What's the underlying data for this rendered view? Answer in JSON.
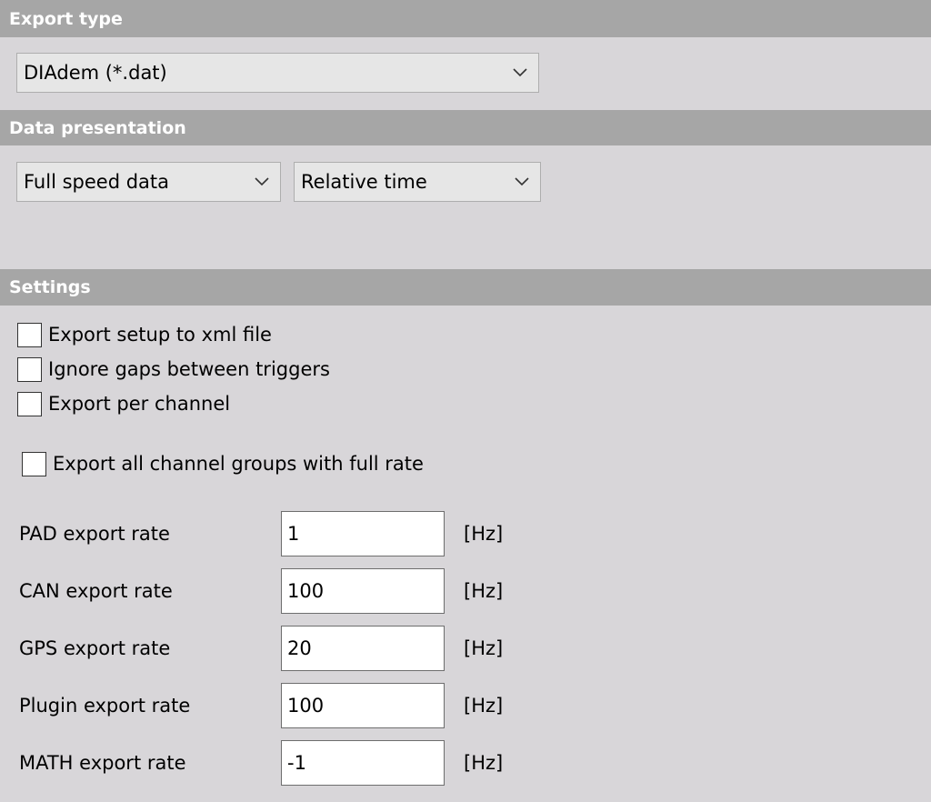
{
  "export_type": {
    "header": "Export type",
    "selected": "DIAdem (*.dat)"
  },
  "data_presentation": {
    "header": "Data presentation",
    "data_mode": "Full speed data",
    "time_mode": "Relative time"
  },
  "settings": {
    "header": "Settings",
    "checkboxes": [
      {
        "label": "Export setup to xml file",
        "checked": false
      },
      {
        "label": "Ignore gaps between triggers",
        "checked": false
      },
      {
        "label": "Export per channel",
        "checked": false
      },
      {
        "label": "Export all channel groups with full rate",
        "checked": false
      }
    ],
    "rates": [
      {
        "label": "PAD export rate",
        "value": "1",
        "unit": "[Hz]"
      },
      {
        "label": "CAN export rate",
        "value": "100",
        "unit": "[Hz]"
      },
      {
        "label": "GPS export rate",
        "value": "20",
        "unit": "[Hz]"
      },
      {
        "label": "Plugin export rate",
        "value": "100",
        "unit": "[Hz]"
      },
      {
        "label": "MATH export rate",
        "value": "-1",
        "unit": "[Hz]"
      }
    ]
  },
  "colors": {
    "background": "#d8d6d9",
    "header": "#a6a6a6",
    "header_text": "#ffffff"
  }
}
